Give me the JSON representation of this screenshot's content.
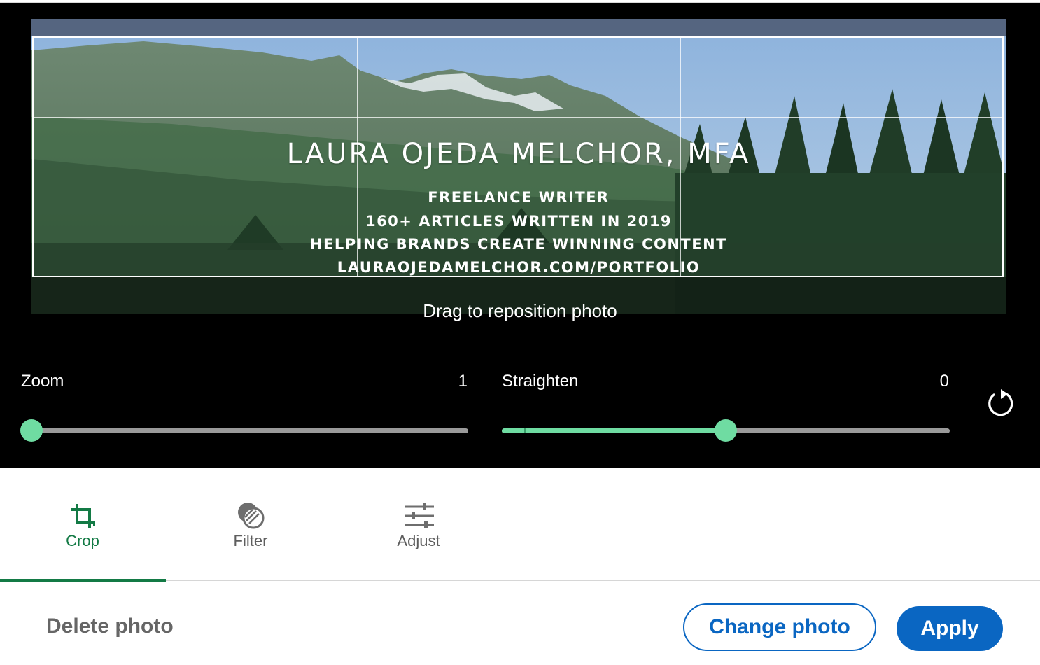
{
  "photo": {
    "title": "LAURA OJEDA MELCHOR, MFA",
    "lines": [
      "FREELANCE WRITER",
      "160+ ARTICLES WRITTEN IN 2019",
      "HELPING BRANDS CREATE WINNING CONTENT",
      "LAURAOJEDAMELCHOR.COM/PORTFOLIO"
    ],
    "hint": "Drag to reposition photo"
  },
  "controls": {
    "zoom": {
      "label": "Zoom",
      "value": "1",
      "level": 0.0
    },
    "straighten": {
      "label": "Straighten",
      "value": "0",
      "level": 0.5
    },
    "rotate_icon": "rotate-clockwise-icon"
  },
  "tabs": [
    {
      "label": "Crop",
      "icon": "crop-icon",
      "active": true
    },
    {
      "label": "Filter",
      "icon": "filter-icon",
      "active": false
    },
    {
      "label": "Adjust",
      "icon": "sliders-icon",
      "active": false
    }
  ],
  "footer": {
    "delete_label": "Delete photo",
    "change_label": "Change photo",
    "apply_label": "Apply"
  },
  "colors": {
    "accent_green": "#137a45",
    "slider_green": "#6fdca2",
    "primary_blue": "#0a66c2"
  }
}
